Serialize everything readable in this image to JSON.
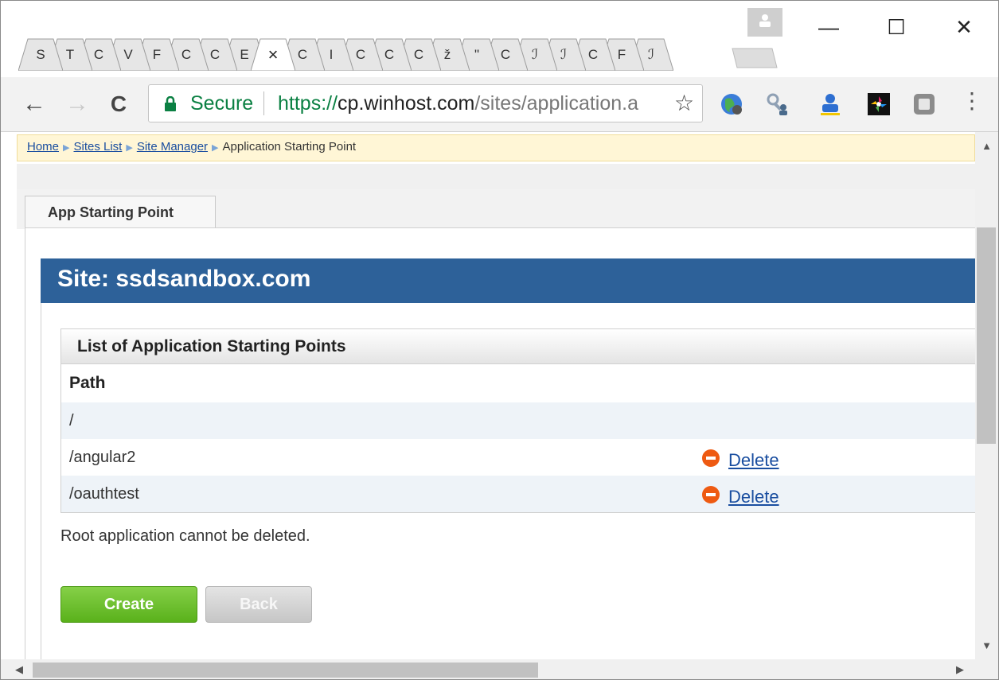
{
  "browser": {
    "tabs": [
      {
        "initial": "S"
      },
      {
        "initial": "T"
      },
      {
        "initial": "C"
      },
      {
        "initial": "V"
      },
      {
        "initial": "F"
      },
      {
        "initial": "C"
      },
      {
        "initial": "C"
      },
      {
        "initial": "E"
      },
      {
        "initial": "×",
        "active": true
      },
      {
        "initial": "C"
      },
      {
        "initial": "I"
      },
      {
        "initial": "C"
      },
      {
        "initial": "C"
      },
      {
        "initial": "C"
      },
      {
        "initial": "ž"
      },
      {
        "initial": "\""
      },
      {
        "initial": "C"
      },
      {
        "initial": "ℐ"
      },
      {
        "initial": "ℐ"
      },
      {
        "initial": "C"
      },
      {
        "initial": "F"
      },
      {
        "initial": "ℐ"
      }
    ],
    "window_controls": {
      "minimize": "—",
      "maximize": "☐",
      "close": "✕"
    },
    "nav": {
      "back": "←",
      "forward": "→",
      "reload": "C"
    },
    "address": {
      "secure_label": "Secure",
      "scheme": "https://",
      "host": "cp.winhost.com",
      "path": "/sites/application.a"
    },
    "star": "☆",
    "menu": "⋮",
    "extensions": [
      "globe-icon",
      "search-person-icon",
      "user-badge-icon",
      "pinwheel-icon",
      "gray-square-icon"
    ]
  },
  "breadcrumb": {
    "home": "Home",
    "sites_list": "Sites List",
    "site_manager": "Site Manager",
    "current": "Application Starting Point"
  },
  "page_tab": "App Starting Point",
  "site_header": "Site: ssdsandbox.com",
  "list": {
    "title": "List of Application Starting Points",
    "column_path": "Path",
    "rows": [
      {
        "path": "/",
        "action": ""
      },
      {
        "path": "/angular2",
        "action": "Delete"
      },
      {
        "path": "/oauthtest",
        "action": "Delete"
      }
    ]
  },
  "note": "Root application cannot be deleted.",
  "buttons": {
    "create": "Create",
    "back": "Back"
  },
  "colors": {
    "site_header": "#2d6199",
    "create": "#5ab11b",
    "delete_icon": "#ee5a12",
    "secure": "#0b8043"
  }
}
